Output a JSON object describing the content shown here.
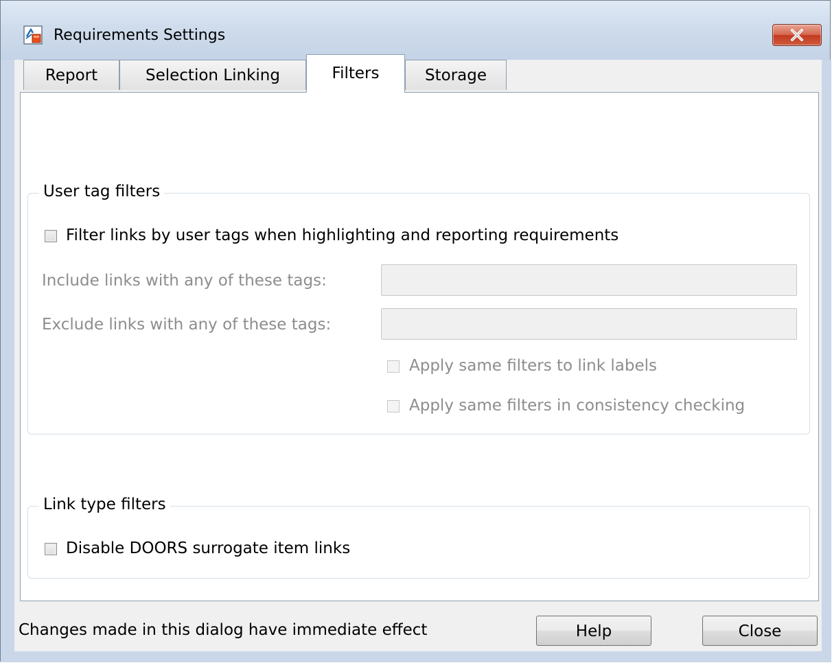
{
  "window": {
    "title": "Requirements Settings",
    "app_icon": "simulink-requirements-icon",
    "close_icon": "close-icon"
  },
  "tabs": [
    {
      "label": "Report",
      "active": false
    },
    {
      "label": "Selection Linking",
      "active": false
    },
    {
      "label": "Filters",
      "active": true
    },
    {
      "label": "Storage",
      "active": false
    }
  ],
  "user_tag_filters": {
    "title": "User tag filters",
    "filter_checkbox": {
      "label": "Filter links by user tags when highlighting and reporting requirements",
      "checked": false
    },
    "include": {
      "label": "Include links with any of these tags:",
      "value": "",
      "enabled": false
    },
    "exclude": {
      "label": "Exclude links with any of these tags:",
      "value": "",
      "enabled": false
    },
    "apply_labels": {
      "label": "Apply same filters to link labels",
      "checked": false,
      "enabled": false
    },
    "apply_consistency": {
      "label": "Apply same filters in consistency checking",
      "checked": false,
      "enabled": false
    }
  },
  "link_type_filters": {
    "title": "Link type filters",
    "doors_checkbox": {
      "label": "Disable DOORS surrogate item links",
      "checked": false
    }
  },
  "footer": {
    "note": "Changes made in this dialog have immediate effect",
    "help_label": "Help",
    "close_label": "Close"
  }
}
